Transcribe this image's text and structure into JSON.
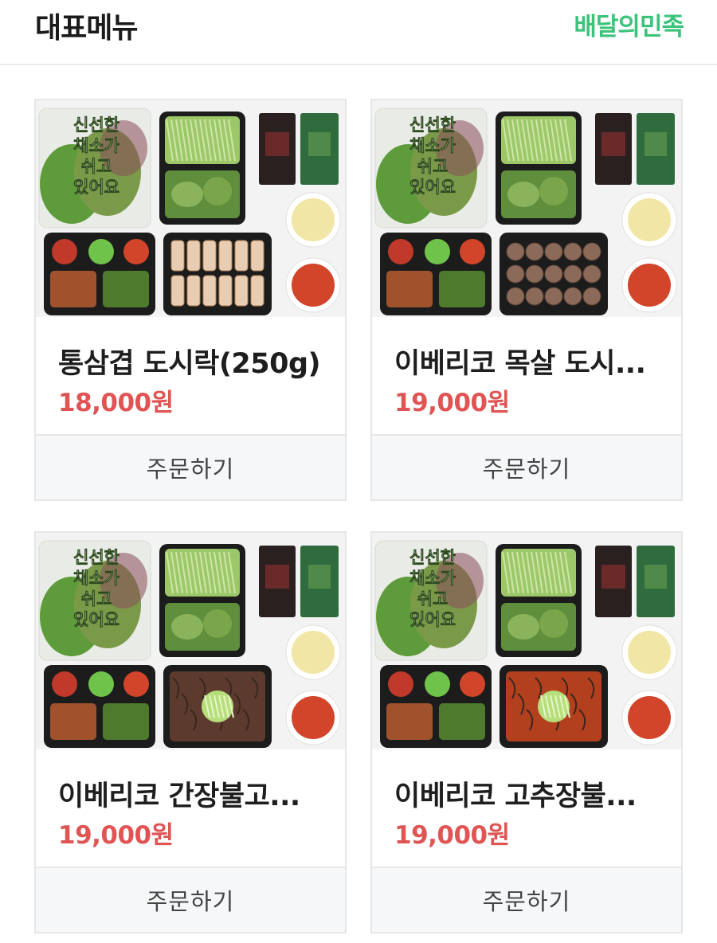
{
  "header": {
    "title": "대표메뉴",
    "brand_link": "배달의민족",
    "brand_color": "#3cc37a"
  },
  "menu": [
    {
      "name": "통삼겹 도시락(250g)",
      "price": "18,000원",
      "order_label": "주문하기",
      "main_dish": "samgyeopsal",
      "package_text": [
        "신선한",
        "채소가",
        "쉬고",
        "있어요"
      ]
    },
    {
      "name": "이베리코 목살 도시...",
      "price": "19,000원",
      "order_label": "주문하기",
      "main_dish": "moksal",
      "package_text": [
        "신선한",
        "채소가",
        "쉬고",
        "있어요"
      ]
    },
    {
      "name": "이베리코 간장불고...",
      "price": "19,000원",
      "order_label": "주문하기",
      "main_dish": "ganjang-bulgogi",
      "package_text": [
        "신선한",
        "채소가",
        "쉬고",
        "있어요"
      ]
    },
    {
      "name": "이베리코 고추장불...",
      "price": "19,000원",
      "order_label": "주문하기",
      "main_dish": "gochujang-bulgogi",
      "package_text": [
        "신선한",
        "채소가",
        "쉬고",
        "있어요"
      ]
    }
  ],
  "colors": {
    "price": "#e05454",
    "tray": "#1c1c1c",
    "lettuce": "#5e9b3a",
    "sauce_red": "#d2452a",
    "sauce_green": "#2f6b3c"
  }
}
